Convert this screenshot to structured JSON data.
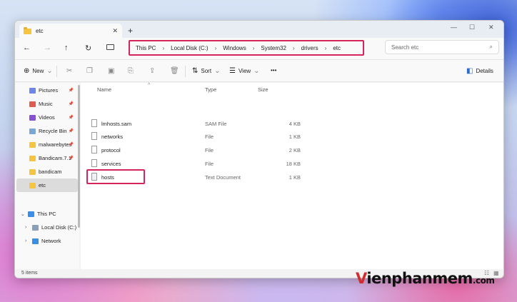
{
  "tab": {
    "title": "etc",
    "close": "✕",
    "new": "+"
  },
  "window_controls": {
    "minimize": "—",
    "maximize": "☐",
    "close": "✕"
  },
  "nav": {
    "back": "←",
    "forward": "→",
    "up": "↑",
    "refresh": "↻"
  },
  "breadcrumb": [
    "This PC",
    "Local Disk (C:)",
    "Windows",
    "System32",
    "drivers",
    "etc"
  ],
  "breadcrumb_sep": "›",
  "search": {
    "placeholder": "Search etc",
    "icon": "⌕"
  },
  "commands": {
    "new": "New",
    "sort": "Sort",
    "view": "View",
    "more": "•••",
    "details": "Details",
    "chevron": "⌄"
  },
  "sidebar": {
    "items": [
      {
        "label": "Pictures",
        "pinned": true,
        "color": "#6d86e8"
      },
      {
        "label": "Music",
        "pinned": true,
        "color": "#e05a4d"
      },
      {
        "label": "Videos",
        "pinned": true,
        "color": "#8a4fd6"
      },
      {
        "label": "Recycle Bin",
        "pinned": true,
        "color": "#7aa6d9"
      },
      {
        "label": "malwarebytes",
        "pinned": true,
        "color": "#f5c542"
      },
      {
        "label": "Bandicam.7.1",
        "pinned": true,
        "color": "#f5c542"
      },
      {
        "label": "bandicam",
        "pinned": false,
        "color": "#f5c542"
      },
      {
        "label": "etc",
        "pinned": false,
        "color": "#f5c542",
        "selected": true
      }
    ],
    "tree": [
      {
        "label": "This PC",
        "expander": "⌄"
      },
      {
        "label": "Local Disk (C:)",
        "expander": "›"
      },
      {
        "label": "Network",
        "expander": "›"
      }
    ],
    "pin_glyph": "📌"
  },
  "columns": {
    "name": "Name",
    "type": "Type",
    "size": "Size",
    "sort_indicator": "^"
  },
  "files": [
    {
      "name": "lmhosts.sam",
      "type": "SAM File",
      "size": "4 KB"
    },
    {
      "name": "networks",
      "type": "File",
      "size": "1 KB"
    },
    {
      "name": "protocol",
      "type": "File",
      "size": "2 KB"
    },
    {
      "name": "services",
      "type": "File",
      "size": "18 KB"
    },
    {
      "name": "hosts",
      "type": "Text Document",
      "size": "1 KB",
      "highlighted": true
    }
  ],
  "status": {
    "items": "5 items"
  },
  "watermark": {
    "v": "V",
    "rest": "ienphanmem",
    "com": ".com"
  },
  "accent": "#d6245c"
}
